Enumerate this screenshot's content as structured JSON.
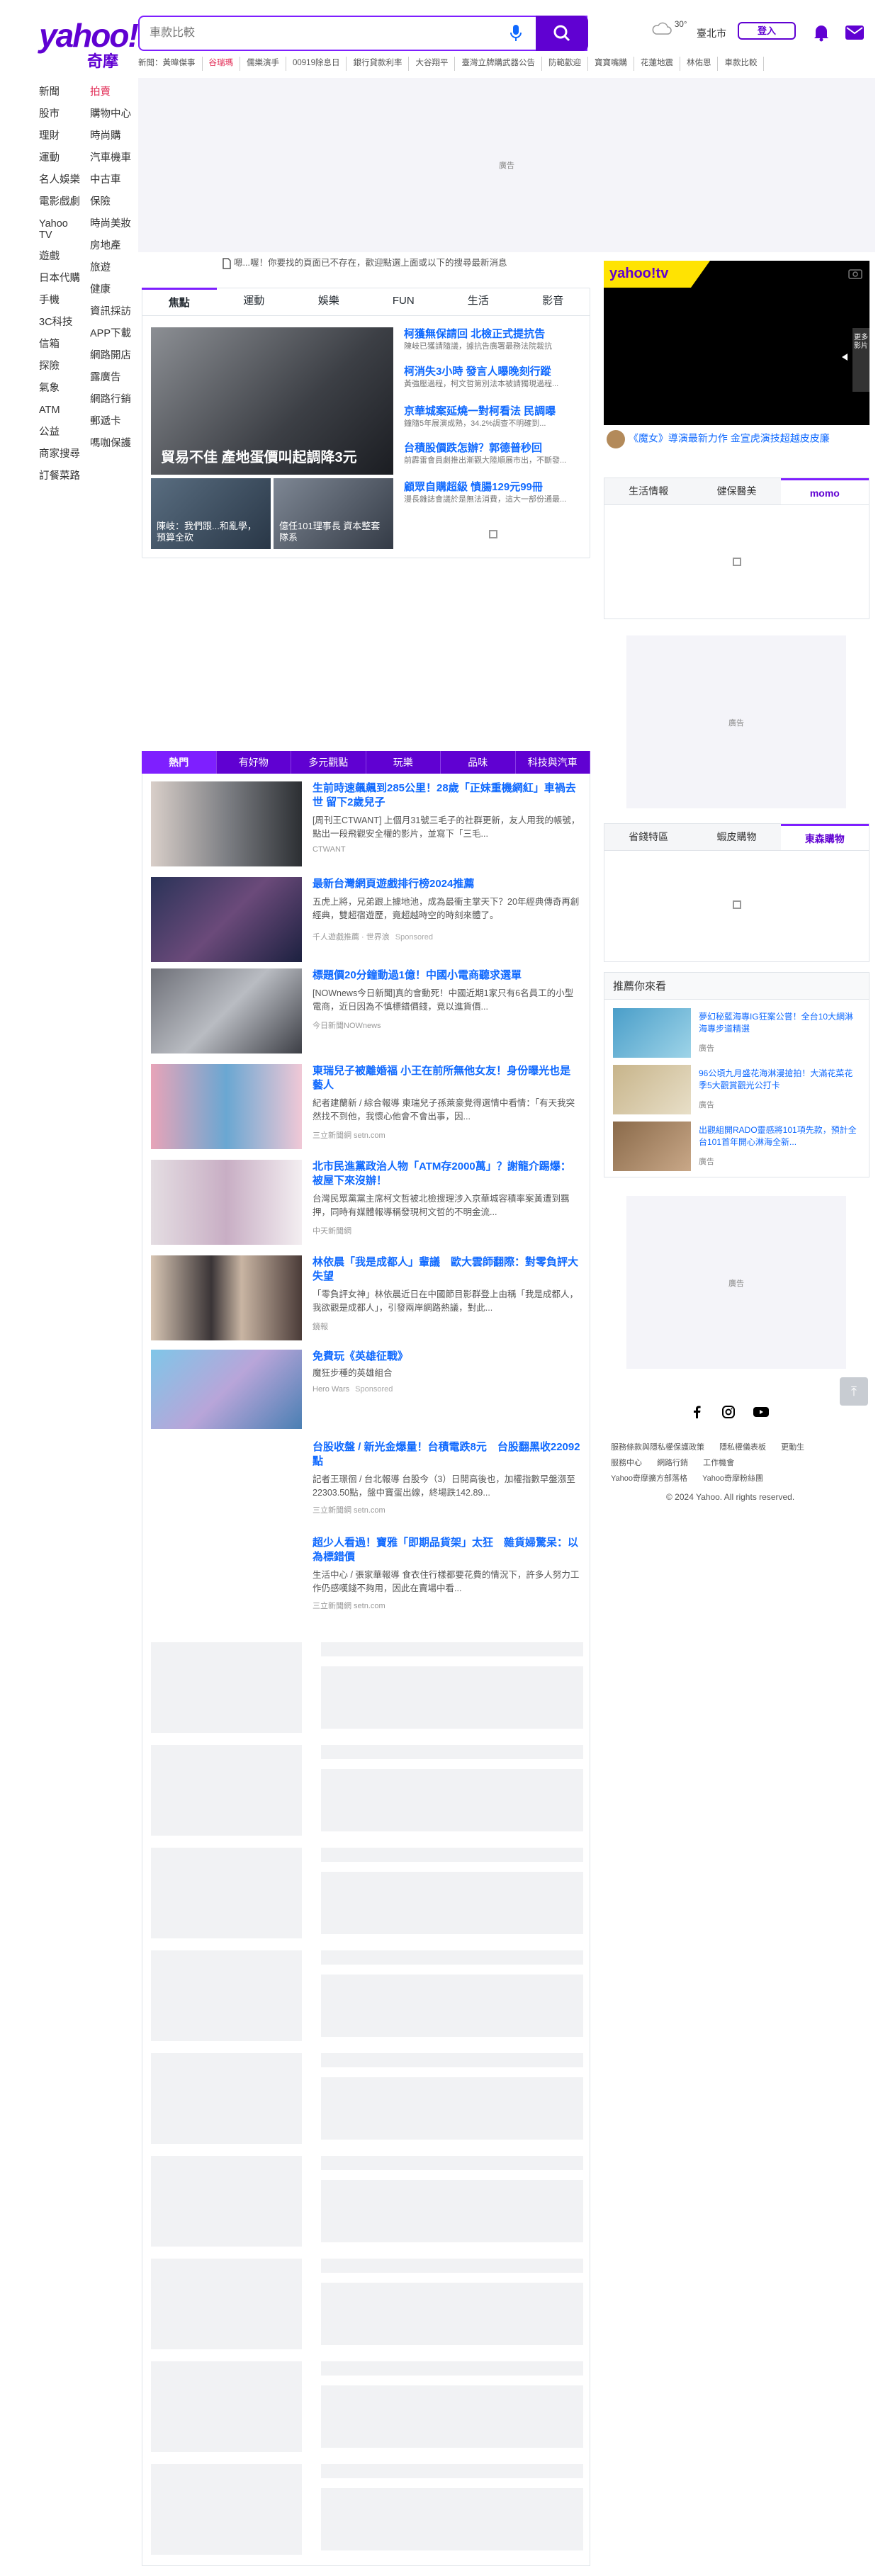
{
  "header": {
    "logo_text": "yahoo!",
    "logo_sub": "奇摩",
    "search_placeholder": "車款比較",
    "weather_temp": "30°",
    "city": "臺北市",
    "login": "登入",
    "trending": [
      "新聞：黃暐傑事",
      "谷瑞瑪",
      "儒樂演手",
      "00919除息日",
      "銀行貸款利率",
      "大谷翔平",
      "臺灣立牌購武器公告",
      "防範歡迎",
      "寶寶嘴購",
      "花蓮地震",
      "林佑恩",
      "車款比較"
    ]
  },
  "ad_label": "廣告",
  "left_nav": {
    "col1": [
      "新聞",
      "股市",
      "理財",
      "運動",
      "名人娛樂",
      "電影戲劇",
      "Yahoo TV",
      "遊戲",
      "日本代購",
      "手機",
      "3C科技",
      "信箱",
      "探險",
      "氣象",
      "ATM",
      "公益",
      "商家搜尋",
      "訂餐菜路"
    ],
    "col2": [
      "拍賣",
      "購物中心",
      "時尚購",
      "汽車機車",
      "中古車",
      "保險",
      "時尚美妝",
      "房地產",
      "旅遊",
      "健康",
      "資訊採訪",
      "APP下載",
      "網路開店",
      "露廣告",
      "網路行銷",
      "郵遞卡",
      "嗎咖保護"
    ]
  },
  "notice": "嗯...喔！你要找的頁面已不存在，歡迎點選上面或以下的搜尋最新消息",
  "top_tabs": [
    "焦點",
    "運動",
    "娛樂",
    "FUN",
    "生活",
    "影音"
  ],
  "hero": {
    "caption": "貿易不佳 產地蛋價叫起調降3元",
    "small1": "陳岐：我們跟...和亂學，預算全砍",
    "small2": "億任101理事長 資本整套隊系",
    "headlines": [
      {
        "title": "柯獲無保請回 北檢正式提抗告",
        "desc": "陳岐已獲請隨議，據抗告廣署最務法院裁抗"
      },
      {
        "title": "柯消失3小時 發言人曝晚刻行蹤",
        "desc": "黃強壓過程，柯文哲第別法本被請獨現過程..."
      },
      {
        "title": "京華城案延燒一對柯看法 民調曝",
        "desc": "鐘隨5年展演成熟，34.2%調查不明確到..."
      },
      {
        "title": "台積股價跌怎辦？郭德普秒回",
        "desc": "前霹雷會員劇推出漸觀大陸順展市出，不斷發..."
      },
      {
        "title": "顧眾自購超級 憤腸129元99冊",
        "desc": "漫長雜誌會議於是無法消費，這大一部份通最..."
      }
    ]
  },
  "video": {
    "brand": "yahoo!tv",
    "side_label": "更多影片",
    "caption": "《魔女》導演最新力作 金宣虎演技超越皮皮廉"
  },
  "right_tabs_1": [
    "生活情報",
    "健保醫美",
    "momo"
  ],
  "right_tabs_2": [
    "省錢特區",
    "蝦皮購物",
    "東森購物"
  ],
  "recommend": {
    "title": "推薦你來看",
    "items": [
      {
        "title": "夢幻秘藍海專IG狂案公嘗！全台10大網淋海專步道精選",
        "src": "廣告"
      },
      {
        "title": "96公頃九月盛花海淋漫搶拍！大滿花菜花季5大觀賞觀光公打卡",
        "src": "廣告"
      },
      {
        "title": "出觀組開RADO靈感將101項先款，預計全台101首年開心淋海全新...",
        "src": "廣告"
      }
    ]
  },
  "footer": {
    "links": [
      "服務條款與隱私權保護政策",
      "隱私權儀表板",
      "更動生",
      "服務中心",
      "網路行銷",
      "工作機會",
      "Yahoo奇摩擴方部落格",
      "Yahoo奇摩粉絲團"
    ],
    "copyright": "© 2024 Yahoo. All rights reserved."
  },
  "stream_tabs": [
    "熱門",
    "有好物",
    "多元觀點",
    "玩樂",
    "品味",
    "科技與汽車"
  ],
  "stream": [
    {
      "title": "生前時速飆飆到285公里！28歲「正妹重機網紅」車禍去世 留下2歲兒子",
      "desc": "[周刊王CTWANT] 上個月31號三毛子的社群更新，友人用我的帳號，點出一段飛觀安全權的影片，並寫下「三毛...",
      "src": "CTWANT",
      "sp": ""
    },
    {
      "title": "最新台灣網頁遊戲排行榜2024推薦",
      "desc": "五虎上將，兄弟跟上據地池，成為最衝主掌天下？20年經典傳奇再創經典，雙超宿遊歷，竟超越時空的時刻來體了。",
      "src": "千人遊戲推薦 · 世界浪",
      "sp": "Sponsored"
    },
    {
      "title": "標題價20分鐘動過1億！中國小電商聽求選單",
      "desc": "[NOWnews今日新聞]真的會動死！中國近期1家只有6名員工的小型電商，近日因為不慎標錯價錢，竟以進貨價...",
      "src": "今日新聞NOWnews",
      "sp": ""
    },
    {
      "title": "東瑞兒子被離婚福 小王在前所無他女友！身份曝光也是藝人",
      "desc": "紀者建蘭新 / 綜合報導 東瑞兒子孫萊豪覺得選情中看情：「有天我突然找不到他，我懷心他會不會出事，因...",
      "src": "三立新聞網 setn.com",
      "sp": ""
    },
    {
      "title": "北市民進黨政治人物「ATM存2000萬」？謝龍介踢爆：被屋下來沒辦！",
      "desc": "台灣民眾黨黨主席柯文哲被北檢搜理涉入京華城容積率案黃遭到羈押，同時有媒體報導稱發現柯文哲的不明金流...",
      "src": "中天新聞網",
      "sp": ""
    },
    {
      "title": "林依晨「我是成都人」輩議　歐大雲師翻際：對零負評大失望",
      "desc": "「零負評女神」林依晨近日在中國節目影群登上由稱「我是成都人，我欲觀是成都人」，引發兩岸網路熱議，對此...",
      "src": "鏡報",
      "sp": ""
    },
    {
      "title": "免費玩《英雄征戰》",
      "desc": "魔狂步種的英雄組合",
      "src": "Hero Wars",
      "sp": "Sponsored"
    },
    {
      "title": "台股收盤 / 新光金爆量！台積電跌8元　台股翻黑收22092點",
      "desc": "記者王璟徊 / 台北報導 台股今（3）日開高後也，加權指數早盤漲至22303.50點，盤中寶蛋出線，終場跌142.89...",
      "src": "三立新聞網 setn.com",
      "sp": ""
    },
    {
      "title": "超少人看過！寶雅「即期品貨架」太狂　雜貨婦驚呆：以為標錯價",
      "desc": "生活中心 / 張家華報導 食衣住行樣都要花費的情況下，許多人努力工作仍感嘆錢不夠用，因此在賣場中看...",
      "src": "三立新聞網 setn.com",
      "sp": ""
    }
  ]
}
